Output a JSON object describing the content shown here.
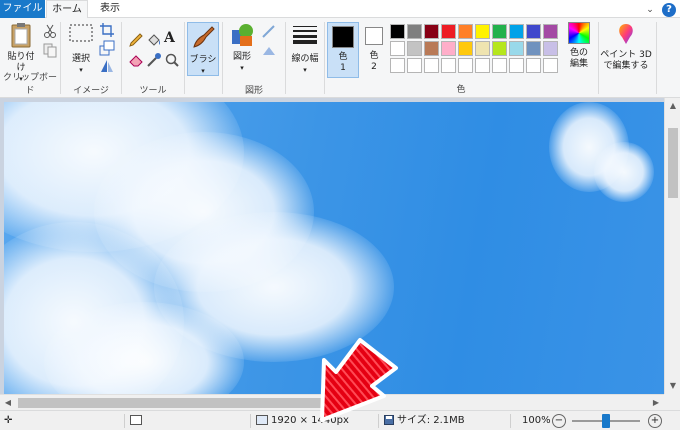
{
  "tabs": {
    "file": "ファイル",
    "home": "ホーム",
    "view": "表示"
  },
  "clipboard": {
    "paste": "貼り付け",
    "group": "クリップボード"
  },
  "image": {
    "select": "選択",
    "group": "イメージ"
  },
  "tools": {
    "group": "ツール"
  },
  "brush": {
    "label": "ブラシ"
  },
  "shapes": {
    "label": "図形",
    "group": "図形"
  },
  "size": {
    "label": "線の幅"
  },
  "color1": {
    "label": "色",
    "num": "1"
  },
  "color2": {
    "label": "色",
    "num": "2"
  },
  "colors": {
    "group": "色",
    "edit_line1": "色の",
    "edit_line2": "編集",
    "palette": [
      "#000000",
      "#7f7f7f",
      "#880015",
      "#ed1c24",
      "#ff7f27",
      "#fff200",
      "#22b14c",
      "#00a2e8",
      "#3f48cc",
      "#a349a4",
      "#ffffff",
      "#c3c3c3",
      "#b97a57",
      "#ffaec9",
      "#ffc90e",
      "#efe4b0",
      "#b5e61d",
      "#99d9ea",
      "#7092be",
      "#c8bfe7",
      "#ffffff",
      "#ffffff",
      "#ffffff",
      "#ffffff",
      "#ffffff",
      "#ffffff",
      "#ffffff",
      "#ffffff",
      "#ffffff",
      "#ffffff"
    ]
  },
  "paint3d": {
    "line1": "ペイント 3D",
    "line2": "で編集する"
  },
  "status": {
    "dimensions": "1920 × 1440px",
    "size": "サイズ: 2.1MB",
    "zoom": "100%"
  },
  "accent_color": "#1979ca"
}
